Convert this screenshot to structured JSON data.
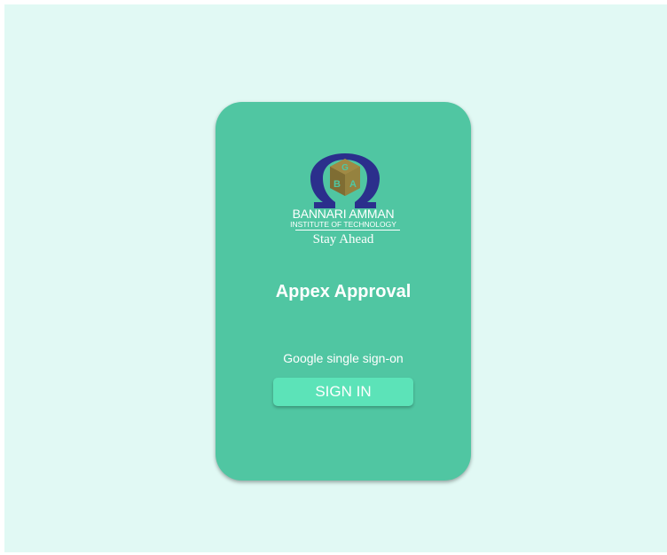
{
  "logo": {
    "name": "BANNARI AMMAN",
    "subname": "INSTITUTE OF TECHNOLOGY",
    "tagline": "Stay Ahead",
    "emblem_letters": "BIT",
    "colors": {
      "omega": "#2b2f8c",
      "cube": "#8d7a3b"
    }
  },
  "app": {
    "title": "Appex Approval"
  },
  "sso": {
    "label": "Google single sign-on",
    "button_label": "SIGN IN"
  },
  "colors": {
    "background": "#e1f9f4",
    "card": "#50c6a2",
    "button": "#5ce3b8",
    "text": "#ffffff"
  }
}
